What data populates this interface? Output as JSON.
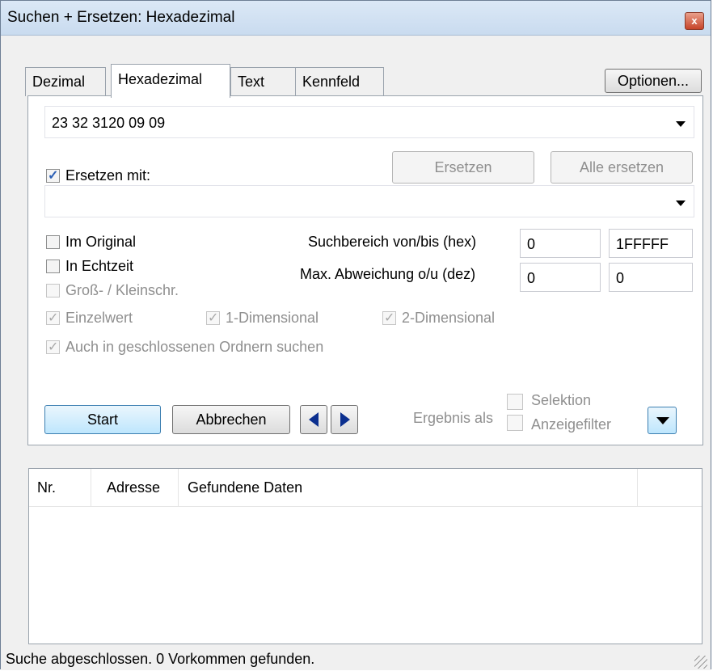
{
  "window": {
    "title": "Suchen + Ersetzen: Hexadezimal",
    "close_label": "x"
  },
  "tabs": [
    {
      "label": "Dezimal"
    },
    {
      "label": "Hexadezimal"
    },
    {
      "label": "Text"
    },
    {
      "label": "Kennfeld"
    }
  ],
  "options_button": "Optionen...",
  "search": {
    "value": "23 32 3120 09 09"
  },
  "replace": {
    "checkbox_label": "Ersetzen mit:",
    "checked": true,
    "value": "",
    "replace_button": "Ersetzen",
    "replace_all_button": "Alle ersetzen"
  },
  "checkboxes": {
    "im_original": "Im Original",
    "in_echtzeit": "In Echtzeit",
    "gross_klein": "Groß- / Kleinschr.",
    "einzelwert": "Einzelwert",
    "eindimensional": "1-Dimensional",
    "zweidimensional": "2-Dimensional",
    "geschlossene_ordner": "Auch in geschlossenen Ordnern suchen"
  },
  "range": {
    "label": "Suchbereich von/bis (hex)",
    "from": "0",
    "to": "1FFFFF"
  },
  "deviation": {
    "label": "Max. Abweichung o/u (dez)",
    "over": "0",
    "under": "0"
  },
  "actions": {
    "start": "Start",
    "abbrechen": "Abbrechen"
  },
  "result_as": {
    "label": "Ergebnis als",
    "selektion": "Selektion",
    "anzeigefilter": "Anzeigefilter"
  },
  "results": {
    "columns": [
      "Nr.",
      "Adresse",
      "Gefundene Daten"
    ],
    "rows": []
  },
  "status": "Suche abgeschlossen. 0 Vorkommen gefunden.",
  "colors": {
    "title_bar": "#c9dbef",
    "close_button": "#c7442a",
    "nav_arrow": "#0b2f8f",
    "checkbox_mark": "#2b5fb5"
  }
}
